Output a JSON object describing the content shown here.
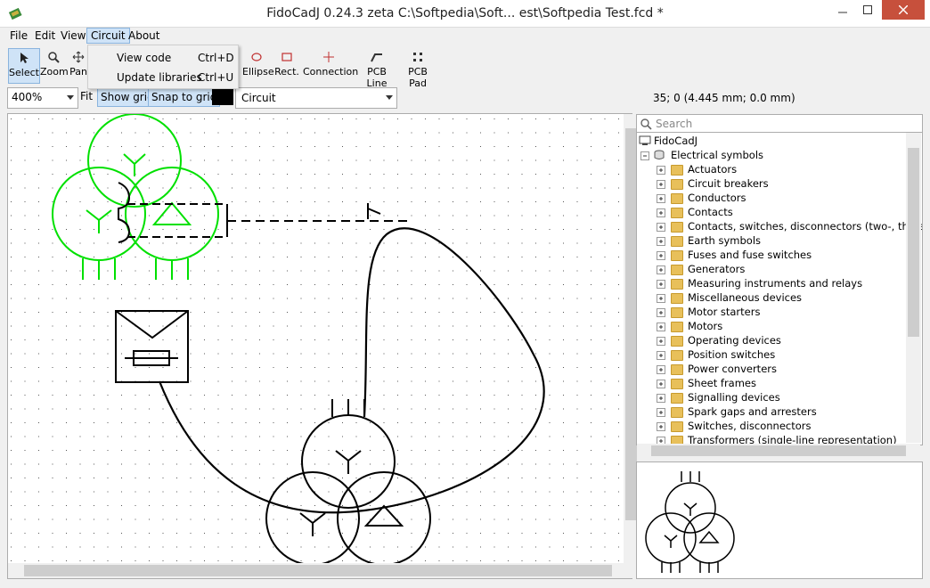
{
  "window": {
    "title": "FidoCadJ 0.24.3 zeta C:\\Softpedia\\Soft...  est\\Softpedia Test.fcd *",
    "controls": {
      "minimize": "–",
      "maximize": "□",
      "close": "✕"
    }
  },
  "menubar": {
    "items": [
      "File",
      "Edit",
      "View",
      "Circuit",
      "About"
    ],
    "active": "Circuit"
  },
  "circuit_menu": {
    "items": [
      {
        "label": "View code",
        "shortcut": "Ctrl+D"
      },
      {
        "label": "Update libraries",
        "shortcut": "Ctrl+U"
      }
    ]
  },
  "toolbar": {
    "tools": [
      {
        "label": "Select",
        "icon": "arrow-icon",
        "selected": true
      },
      {
        "label": "Zoom",
        "icon": "magnifier-icon"
      },
      {
        "label": "Pan",
        "icon": "pan-icon"
      },
      {
        "label": "Ellipse",
        "icon": "ellipse-icon"
      },
      {
        "label": "Rect.",
        "icon": "rectangle-icon"
      },
      {
        "label": "Connection",
        "icon": "connection-icon"
      },
      {
        "label": "PCB Line",
        "icon": "pcb-line-icon"
      },
      {
        "label": "PCB Pad",
        "icon": "pcb-pad-icon"
      }
    ]
  },
  "toolbar2": {
    "zoom": "400%",
    "fit": "Fit",
    "show_grid": "Show grid",
    "snap_to_grid": "Snap to grid",
    "layer_color": "#000000",
    "layer": "Circuit",
    "coords": "35; 0 (4.445 mm; 0.0 mm)"
  },
  "library": {
    "search_placeholder": "Search",
    "root": "FidoCadJ",
    "group": "Electrical symbols",
    "categories": [
      "Actuators",
      "Circuit breakers",
      "Conductors",
      "Contacts",
      "Contacts, switches, disconnectors (two-, three-wa",
      "Earth symbols",
      "Fuses and fuse switches",
      "Generators",
      "Measuring instruments and relays",
      "Miscellaneous devices",
      "Motor starters",
      "Motors",
      "Operating devices",
      "Position switches",
      "Power converters",
      "Sheet frames",
      "Signalling devices",
      "Spark gaps and arresters",
      "Switches, disconnectors",
      "Transformers (single-line representation)"
    ]
  },
  "colors": {
    "selection": "#00e000",
    "drawing": "#000000",
    "accent": "#cfe3f7"
  }
}
